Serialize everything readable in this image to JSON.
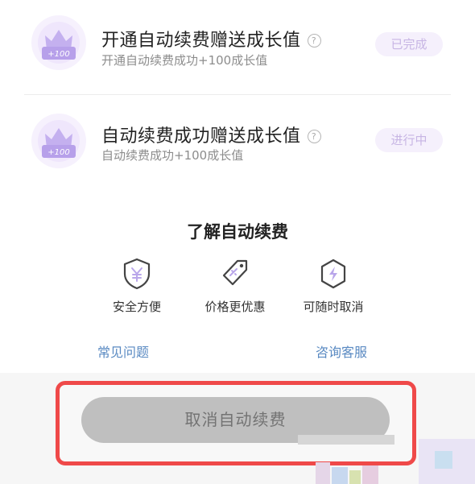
{
  "tasks": [
    {
      "title": "开通自动续费赠送成长值",
      "help": "?",
      "desc": "开通自动续费成功+100成长值",
      "status": "已完成",
      "badge_value": "+100"
    },
    {
      "title": "自动续费成功赠送成长值",
      "help": "?",
      "desc": "自动续费成功+100成长值",
      "status": "进行中",
      "badge_value": "+100"
    }
  ],
  "learn": {
    "title": "了解自动续费",
    "features": [
      {
        "label": "安全方便",
        "icon": "shield-yen-icon"
      },
      {
        "label": "价格更优惠",
        "icon": "price-tag-icon"
      },
      {
        "label": "可随时取消",
        "icon": "lightning-hexagon-icon"
      }
    ]
  },
  "links": {
    "faq": "常见问题",
    "service": "咨询客服"
  },
  "cancel_button": "取消自动续费",
  "colors": {
    "badge": "#c4b0ef",
    "pill_bg": "#f5f0fc",
    "pill_text": "#c7b5e4",
    "link": "#5a8ac2",
    "highlight": "#ef4949",
    "button_bg": "#bfbfbf"
  }
}
